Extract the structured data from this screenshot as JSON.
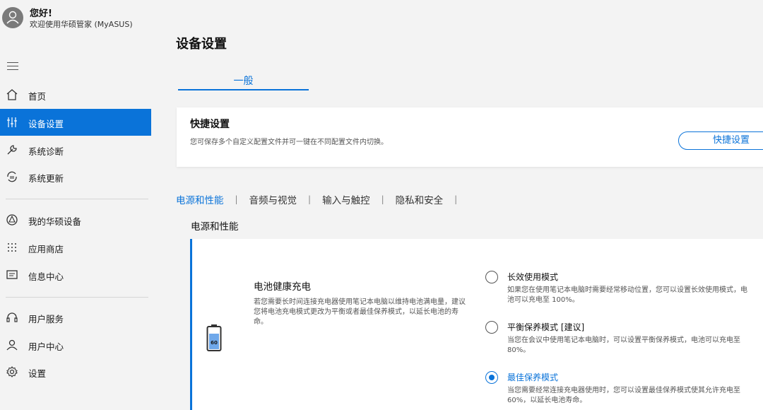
{
  "user": {
    "greeting": "您好!",
    "welcome": "欢迎使用华硕管家 (MyASUS)"
  },
  "sidebar": {
    "items": [
      {
        "label": "首页",
        "icon": "home-icon"
      },
      {
        "label": "设备设置",
        "icon": "sliders-icon",
        "active": true
      },
      {
        "label": "系统诊断",
        "icon": "wrench-icon"
      },
      {
        "label": "系统更新",
        "icon": "update-icon"
      },
      {
        "label": "我的华硕设备",
        "icon": "devices-icon"
      },
      {
        "label": "应用商店",
        "icon": "grid-dots-icon"
      },
      {
        "label": "信息中心",
        "icon": "message-icon"
      },
      {
        "label": "用户服务",
        "icon": "headset-icon"
      },
      {
        "label": "用户中心",
        "icon": "person-icon"
      },
      {
        "label": "设置",
        "icon": "gear-icon"
      }
    ]
  },
  "main": {
    "title": "设备设置",
    "tab": "一般",
    "quick": {
      "title": "快捷设置",
      "description": "您可保存多个自定义配置文件并可一键在不同配置文件内切换。",
      "button": "快捷设置"
    },
    "categories": [
      "电源和性能",
      "音频与视觉",
      "输入与触控",
      "隐私和安全"
    ],
    "section_title": "电源和性能",
    "battery": {
      "title": "电池健康充电",
      "description": "若您需要长时间连接充电器使用笔记本电脑以维持电池满电量，建议您将电池充电模式更改为平衡或者最佳保养模式，以延长电池的寿命。",
      "icon_value": "60",
      "options": [
        {
          "label": "长效使用模式",
          "description": "如果您在使用笔记本电脑时需要经常移动位置，您可以设置长效使用模式，电池可以充电至 100%。",
          "checked": false
        },
        {
          "label": "平衡保养模式 [建议]",
          "description": "当您在会议中使用笔记本电脑时，可以设置平衡保养模式，电池可以充电至 80%。",
          "checked": false
        },
        {
          "label": "最佳保养模式",
          "description": "当您需要经常连接充电器使用时，您可以设置最佳保养模式使其允许充电至 60%，以延长电池寿命。",
          "checked": true
        }
      ]
    }
  },
  "colors": {
    "accent": "#0a73d9",
    "background": "#f3f3f3",
    "card": "#ffffff"
  }
}
